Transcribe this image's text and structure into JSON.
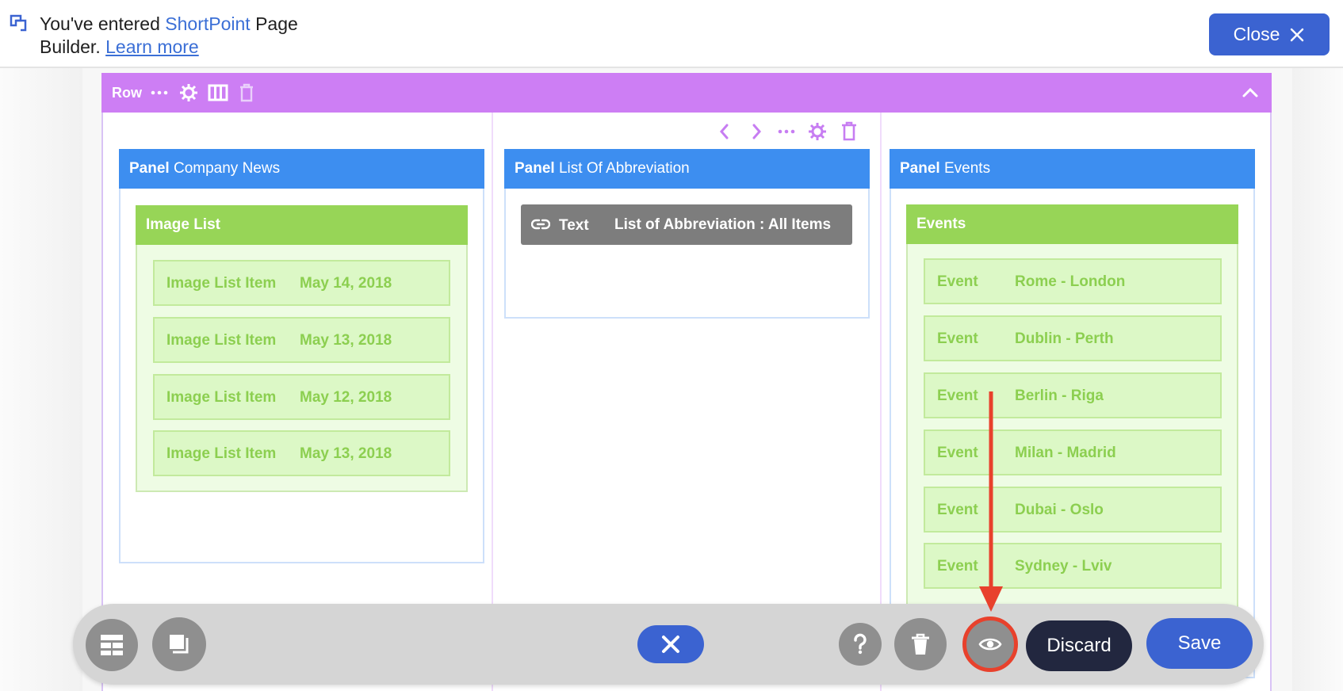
{
  "notice": {
    "prefix": "You've entered ",
    "brand": "ShortPoint",
    "suffix": " Page",
    "line2": "Builder.",
    "link": "Learn more"
  },
  "header": {
    "close_label": "Close"
  },
  "row": {
    "label": "Row"
  },
  "panels": [
    {
      "prefix": "Panel",
      "title": "Company News"
    },
    {
      "prefix": "Panel",
      "title": "List Of Abbreviation"
    },
    {
      "prefix": "Panel",
      "title": "Events"
    }
  ],
  "image_list": {
    "title": "Image List",
    "items": [
      {
        "label": "Image List Item",
        "date": "May 14, 2018"
      },
      {
        "label": "Image List Item",
        "date": "May 13, 2018"
      },
      {
        "label": "Image List Item",
        "date": "May 12, 2018"
      },
      {
        "label": "Image List Item",
        "date": "May 13, 2018"
      }
    ]
  },
  "text_element": {
    "label": "Text",
    "value": "List of Abbreviation : All Items"
  },
  "events": {
    "title": "Events",
    "items": [
      {
        "label": "Event",
        "route": "Rome - London"
      },
      {
        "label": "Event",
        "route": "Dublin - Perth"
      },
      {
        "label": "Event",
        "route": "Berlin - Riga"
      },
      {
        "label": "Event",
        "route": "Milan - Madrid"
      },
      {
        "label": "Event",
        "route": "Dubai - Oslo"
      },
      {
        "label": "Event",
        "route": "Sydney - Lviv"
      }
    ]
  },
  "bottom_toolbar": {
    "discard_label": "Discard",
    "save_label": "Save"
  },
  "colors": {
    "brand_blue": "#3b63d1",
    "row_purple": "#cd7ef4",
    "panel_blue": "#3d8ef0",
    "green": "#97d557",
    "highlight_red": "#e8412c",
    "discard_dark": "#22273f"
  },
  "icons": [
    "shortpoint-logo-icon",
    "close-icon",
    "ellipsis-icon",
    "gear-icon",
    "columns-icon",
    "trash-icon",
    "chevron-up-icon",
    "chevron-left-icon",
    "chevron-right-icon",
    "link-icon",
    "layout-icon",
    "layers-icon",
    "x-icon",
    "help-icon",
    "eye-icon"
  ]
}
